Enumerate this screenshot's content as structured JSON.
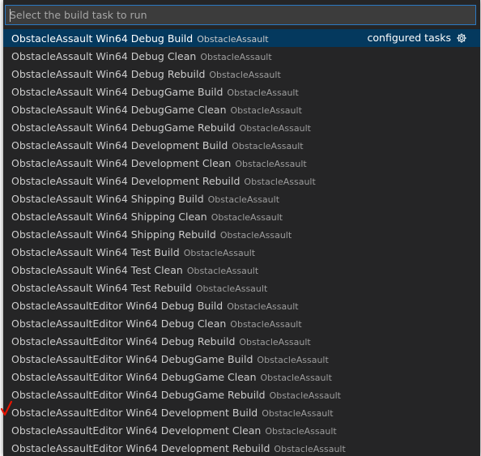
{
  "search": {
    "placeholder": "Select the build task to run"
  },
  "tasks": [
    {
      "label": "ObstacleAssault Win64 Debug Build",
      "desc": "ObstacleAssault",
      "selected": true
    },
    {
      "label": "ObstacleAssault Win64 Debug Clean",
      "desc": "ObstacleAssault"
    },
    {
      "label": "ObstacleAssault Win64 Debug Rebuild",
      "desc": "ObstacleAssault"
    },
    {
      "label": "ObstacleAssault Win64 DebugGame Build",
      "desc": "ObstacleAssault"
    },
    {
      "label": "ObstacleAssault Win64 DebugGame Clean",
      "desc": "ObstacleAssault"
    },
    {
      "label": "ObstacleAssault Win64 DebugGame Rebuild",
      "desc": "ObstacleAssault"
    },
    {
      "label": "ObstacleAssault Win64 Development Build",
      "desc": "ObstacleAssault"
    },
    {
      "label": "ObstacleAssault Win64 Development Clean",
      "desc": "ObstacleAssault"
    },
    {
      "label": "ObstacleAssault Win64 Development Rebuild",
      "desc": "ObstacleAssault"
    },
    {
      "label": "ObstacleAssault Win64 Shipping Build",
      "desc": "ObstacleAssault"
    },
    {
      "label": "ObstacleAssault Win64 Shipping Clean",
      "desc": "ObstacleAssault"
    },
    {
      "label": "ObstacleAssault Win64 Shipping Rebuild",
      "desc": "ObstacleAssault"
    },
    {
      "label": "ObstacleAssault Win64 Test Build",
      "desc": "ObstacleAssault"
    },
    {
      "label": "ObstacleAssault Win64 Test Clean",
      "desc": "ObstacleAssault"
    },
    {
      "label": "ObstacleAssault Win64 Test Rebuild",
      "desc": "ObstacleAssault"
    },
    {
      "label": "ObstacleAssaultEditor Win64 Debug Build",
      "desc": "ObstacleAssault"
    },
    {
      "label": "ObstacleAssaultEditor Win64 Debug Clean",
      "desc": "ObstacleAssault"
    },
    {
      "label": "ObstacleAssaultEditor Win64 Debug Rebuild",
      "desc": "ObstacleAssault"
    },
    {
      "label": "ObstacleAssaultEditor Win64 DebugGame Build",
      "desc": "ObstacleAssault"
    },
    {
      "label": "ObstacleAssaultEditor Win64 DebugGame Clean",
      "desc": "ObstacleAssault"
    },
    {
      "label": "ObstacleAssaultEditor Win64 DebugGame Rebuild",
      "desc": "ObstacleAssault"
    },
    {
      "label": "ObstacleAssaultEditor Win64 Development Build",
      "desc": "ObstacleAssault",
      "annotated": true
    },
    {
      "label": "ObstacleAssaultEditor Win64 Development Clean",
      "desc": "ObstacleAssault"
    },
    {
      "label": "ObstacleAssaultEditor Win64 Development Rebuild",
      "desc": "ObstacleAssault"
    }
  ],
  "selected_row": {
    "right_label": "configured tasks",
    "right_icon": "gear-icon"
  },
  "annotation": {
    "icon": "red-checkmark-icon",
    "color": "#e51400"
  },
  "colors": {
    "background": "#252526",
    "selected_background": "#04395e",
    "focus_border": "#2b79c2"
  }
}
